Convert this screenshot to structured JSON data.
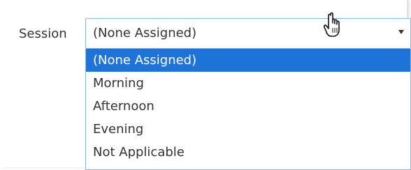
{
  "field": {
    "label": "Session",
    "selected_value": "(None Assigned)"
  },
  "dropdown": {
    "options": [
      {
        "label": "(None Assigned)",
        "selected": true
      },
      {
        "label": "Morning",
        "selected": false
      },
      {
        "label": "Afternoon",
        "selected": false
      },
      {
        "label": "Evening",
        "selected": false
      },
      {
        "label": "Not Applicable",
        "selected": false
      }
    ]
  },
  "colors": {
    "highlight": "#1e73d8",
    "border": "#8fb3d9",
    "text": "#333333"
  },
  "icons": {
    "arrow": "triangle-down-icon",
    "cursor": "hand-pointer-icon"
  }
}
